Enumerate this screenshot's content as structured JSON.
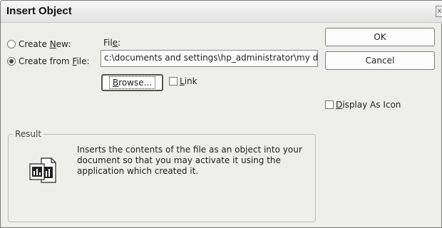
{
  "window": {
    "title": "Insert Object",
    "close_symbol": "x"
  },
  "options": {
    "create_new": {
      "label_pre": "Create ",
      "accel": "N",
      "label_post": "ew:",
      "checked": false
    },
    "create_from_file": {
      "label_pre": "Create from ",
      "accel": "F",
      "label_post": "ile:",
      "checked": true
    }
  },
  "file": {
    "label_pre": "Fil",
    "label_accel": "e",
    "label_post": ":",
    "path": "c:\\documents and settings\\hp_administrator\\my documents"
  },
  "buttons": {
    "ok": "OK",
    "cancel": "Cancel",
    "browse": {
      "accel": "B",
      "rest": "rowse..."
    }
  },
  "link": {
    "accel": "L",
    "rest": "ink",
    "checked": false
  },
  "display_as_icon": {
    "accel": "D",
    "rest": "isplay As Icon",
    "checked": false
  },
  "result": {
    "title": "Result",
    "icon": "embedded-document-icon",
    "text": "Inserts the contents of the file as an object into your document so that you may activate it using the application which created it."
  }
}
